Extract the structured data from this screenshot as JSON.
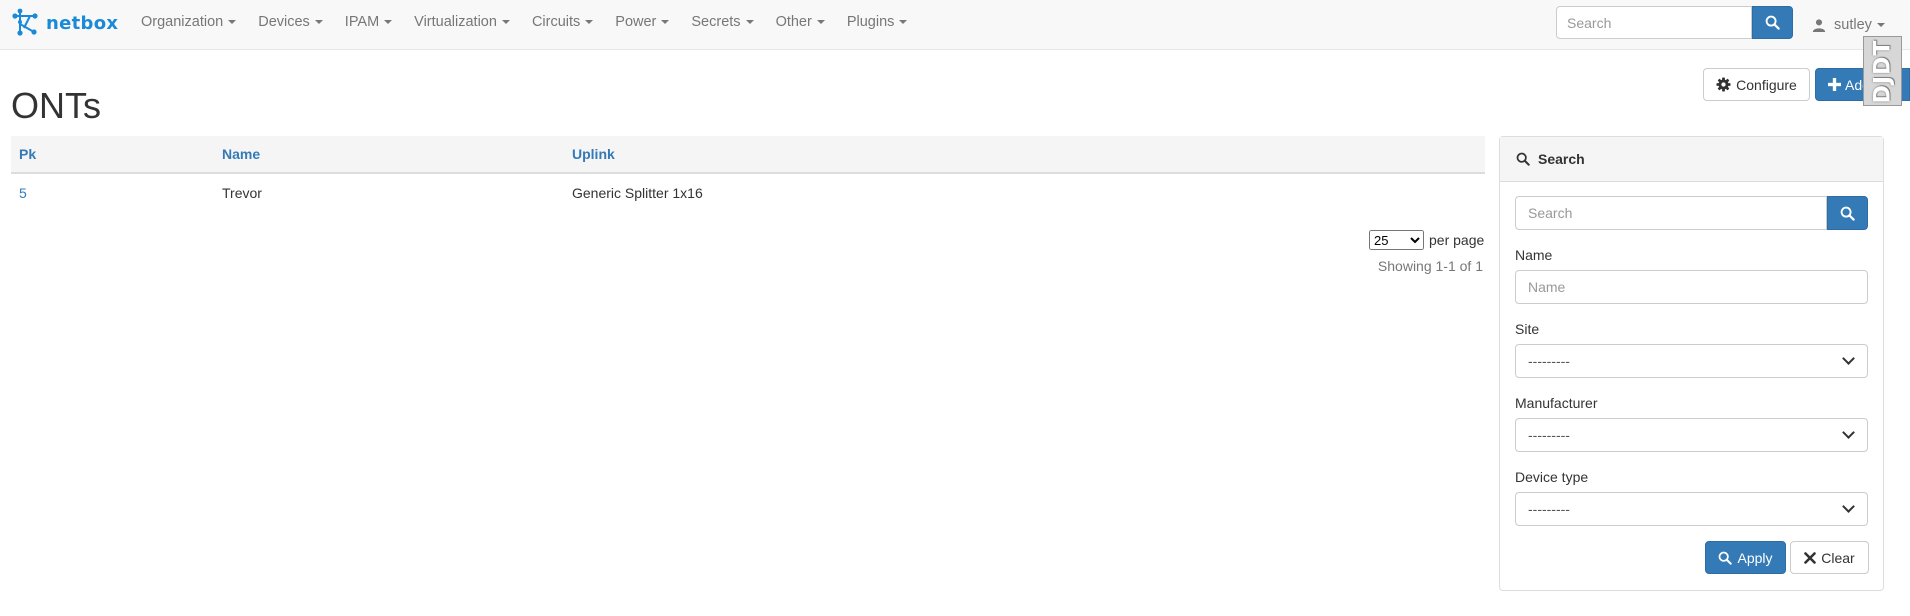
{
  "navbar": {
    "brand": "netbox",
    "items": [
      {
        "label": "Organization"
      },
      {
        "label": "Devices"
      },
      {
        "label": "IPAM"
      },
      {
        "label": "Virtualization"
      },
      {
        "label": "Circuits"
      },
      {
        "label": "Power"
      },
      {
        "label": "Secrets"
      },
      {
        "label": "Other"
      },
      {
        "label": "Plugins"
      }
    ],
    "search_placeholder": "Search",
    "user": "sutley"
  },
  "page": {
    "title": "ONTs",
    "configure_label": "Configure",
    "add_label": "Add",
    "debug_toolbar_label": "DJDT"
  },
  "table": {
    "headers": [
      "Pk",
      "Name",
      "Uplink"
    ],
    "rows": [
      {
        "pk": "5",
        "name": "Trevor",
        "uplink": "Generic Splitter 1x16"
      }
    ]
  },
  "pagination": {
    "per_page_value": "25",
    "per_page_label": "per page",
    "showing": "Showing 1-1 of 1"
  },
  "search_panel": {
    "title": "Search",
    "search_placeholder": "Search",
    "fields": {
      "name": {
        "label": "Name",
        "placeholder": "Name"
      },
      "site": {
        "label": "Site",
        "value": "---------"
      },
      "manufacturer": {
        "label": "Manufacturer",
        "value": "---------"
      },
      "device_type": {
        "label": "Device type",
        "value": "---------"
      }
    },
    "apply_label": "Apply",
    "clear_label": "Clear"
  },
  "colors": {
    "primary": "#337ab7",
    "brand": "#1a8ad8",
    "navbar_bg": "#f8f8f8",
    "nav_text": "#777777"
  }
}
